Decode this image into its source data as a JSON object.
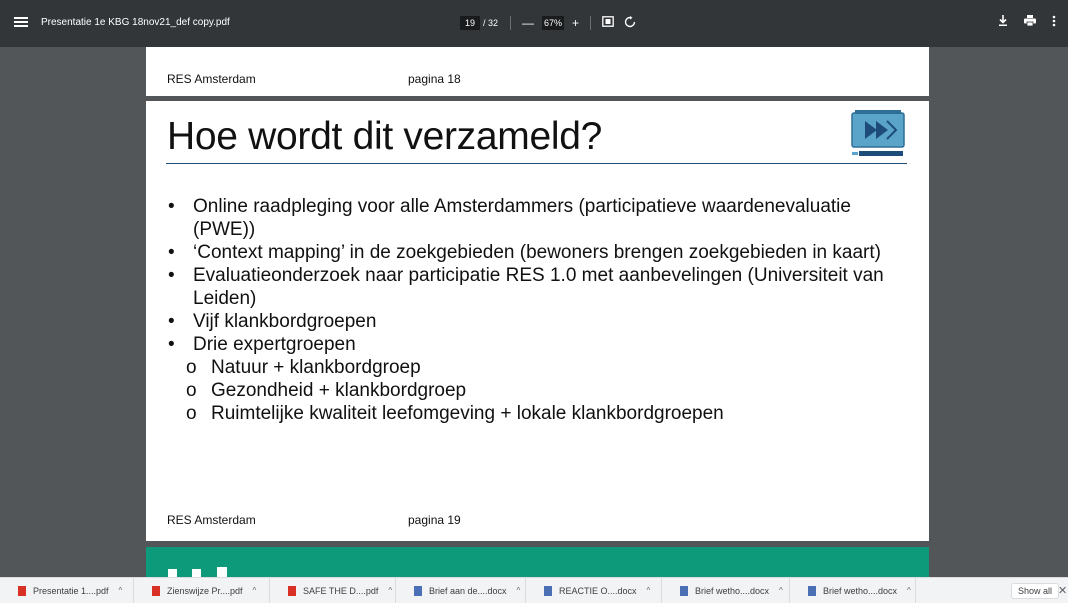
{
  "toolbar": {
    "title": "Presentatie 1e KBG 18nov21_def copy.pdf",
    "page_current": "19",
    "page_total": "/ 32",
    "zoom": "67%",
    "zoom_out": "—",
    "zoom_in": "+"
  },
  "prev_page": {
    "footer_left": "RES Amsterdam",
    "footer_right": "pagina 18"
  },
  "slide": {
    "title": "Hoe wordt dit verzameld?",
    "bullets": [
      {
        "type": "item",
        "text": "Online raadpleging voor alle Amsterdammers (participatieve waardenevaluatie (PWE))"
      },
      {
        "type": "item",
        "text": "‘Context mapping’ in de zoekgebieden (bewoners brengen zoekgebieden in kaart)"
      },
      {
        "type": "item",
        "text": "Evaluatieonderzoek naar participatie RES 1.0 met aanbevelingen (Universiteit van Leiden)"
      },
      {
        "type": "item",
        "text": "Vijf klankbordgroepen"
      },
      {
        "type": "item",
        "text": "Drie expertgroepen"
      },
      {
        "type": "sub",
        "text": "Natuur + klankbordgroep"
      },
      {
        "type": "sub",
        "text": "Gezondheid + klankbordgroep"
      },
      {
        "type": "sub",
        "text": "Ruimtelijke kwaliteit leefomgeving + lokale klankbordgroepen"
      }
    ],
    "footer_left": "RES Amsterdam",
    "footer_right": "pagina 19",
    "accent_color": "#1e4c7a"
  },
  "downloads": {
    "items": [
      {
        "label": "Presentatie 1....pdf",
        "type": "pdf"
      },
      {
        "label": "Zienswijze Pr....pdf",
        "type": "pdf"
      },
      {
        "label": "SAFE THE D....pdf",
        "type": "pdf"
      },
      {
        "label": "Brief aan de....docx",
        "type": "docx"
      },
      {
        "label": "REACTIE O....docx",
        "type": "docx"
      },
      {
        "label": "Brief wetho....docx",
        "type": "docx"
      },
      {
        "label": "Brief wetho....docx",
        "type": "docx"
      }
    ],
    "show_all": "Show all"
  },
  "colors": {
    "pdf": "#d93025",
    "docx": "#4a6fb5",
    "next_page": "#0d9a7a"
  }
}
